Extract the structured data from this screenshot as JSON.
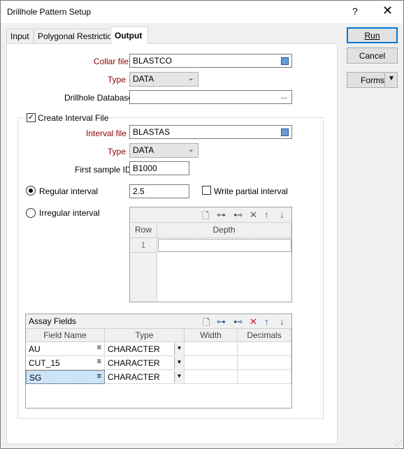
{
  "window": {
    "title": "Drillhole Pattern Setup",
    "help": "?",
    "close": "✕"
  },
  "tabs": [
    {
      "label": "Input"
    },
    {
      "label": "Polygonal Restriction"
    },
    {
      "label": "Output"
    }
  ],
  "buttons": {
    "run": "Run",
    "cancel": "Cancel",
    "forms": "Forms"
  },
  "collar": {
    "label": "Collar file",
    "value": "BLASTCO"
  },
  "collar_type": {
    "label": "Type",
    "value": "DATA"
  },
  "drillhole_db": {
    "label": "Drillhole Database",
    "value": "",
    "browse": "..."
  },
  "interval": {
    "checkbox_label": "Create Interval File",
    "checked": true,
    "file_label": "Interval file",
    "file_value": "BLASTAS",
    "type_label": "Type",
    "type_value": "DATA",
    "first_sample_label": "First sample ID",
    "first_sample_value": "B1000",
    "regular_label": "Regular interval",
    "regular_value": "2.5",
    "write_partial_label": "Write partial interval",
    "irregular_label": "Irregular interval",
    "irregular_grid": {
      "col_row": "Row",
      "col_depth": "Depth",
      "rows": [
        {
          "row": "1",
          "depth": ""
        }
      ]
    }
  },
  "assay": {
    "title": "Assay Fields",
    "columns": [
      "Field Name",
      "Type",
      "Width",
      "Decimals"
    ],
    "rows": [
      {
        "field": "AU",
        "type": "CHARACTER",
        "width": "",
        "decimals": ""
      },
      {
        "field": "CUT_15",
        "type": "CHARACTER",
        "width": "",
        "decimals": ""
      },
      {
        "field": "SG",
        "type": "CHARACTER",
        "width": "",
        "decimals": ""
      }
    ]
  }
}
